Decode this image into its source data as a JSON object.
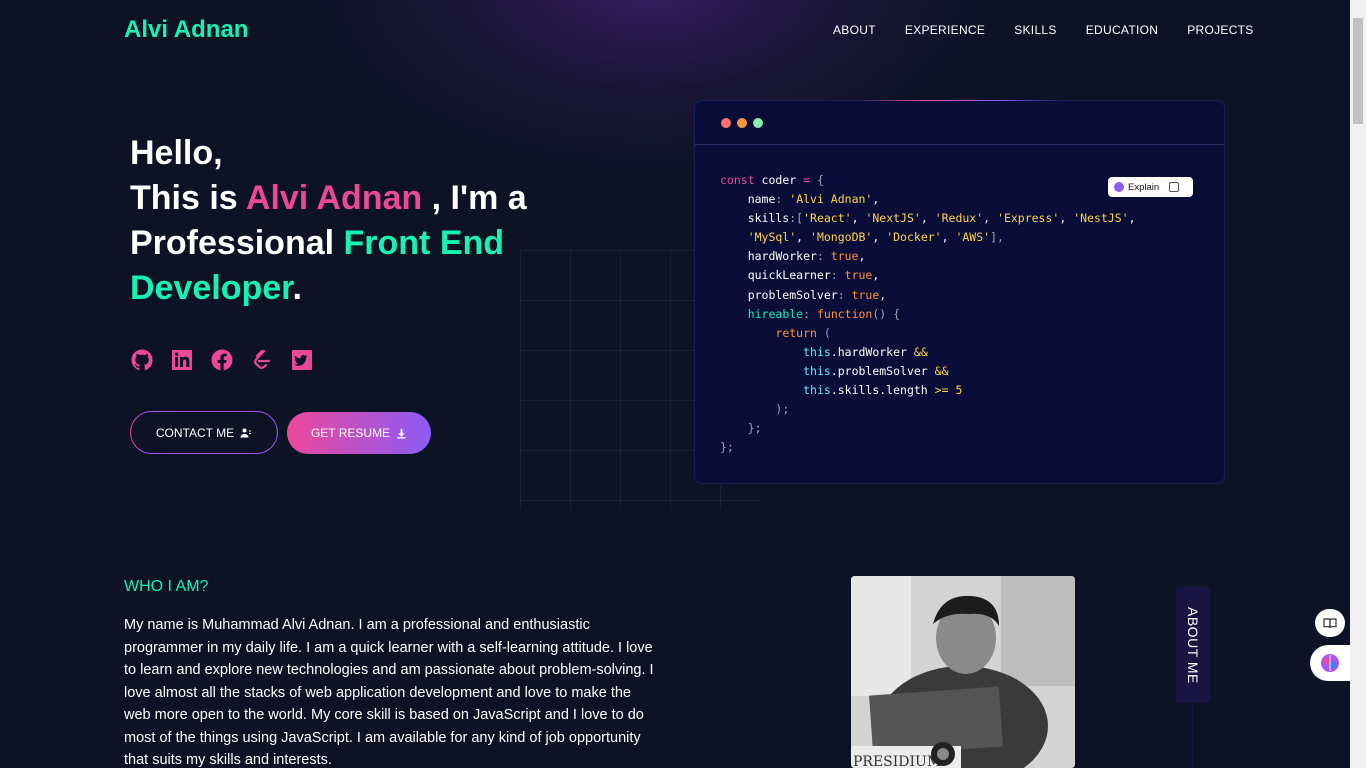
{
  "header": {
    "logo": "Alvi Adnan",
    "nav": [
      "ABOUT",
      "EXPERIENCE",
      "SKILLS",
      "EDUCATION",
      "PROJECTS"
    ]
  },
  "hero": {
    "line1": "Hello,",
    "this_is": "This is ",
    "name": "Alvi Adnan",
    "im_a": " , I'm a",
    "professional": "Professional ",
    "role": "Front End Developer",
    "period": ".",
    "socials": [
      "github-icon",
      "linkedin-icon",
      "facebook-icon",
      "leetcode-icon",
      "twitter-icon"
    ],
    "contact_label": "CONTACT ME",
    "resume_label": "GET RESUME"
  },
  "code": {
    "explain_label": "Explain",
    "name": "'Alvi Adnan'",
    "skills": [
      "'React'",
      "'NextJS'",
      "'Redux'",
      "'Express'",
      "'NestJS'",
      "'MySql'",
      "'MongoDB'",
      "'Docker'",
      "'AWS'"
    ],
    "length_min": "5"
  },
  "about": {
    "heading": "WHO I AM?",
    "text": "My name is Muhammad Alvi Adnan. I am a professional and enthusiastic programmer in my daily life. I am a quick learner with a self-learning attitude. I love to learn and explore new technologies and am passionate about problem-solving. I love almost all the stacks of web application development and love to make the web more open to the world. My core skill is based on JavaScript and I love to do most of the things using JavaScript. I am available for any kind of job opportunity that suits my skills and interests.",
    "tab_label": "ABOUT ME",
    "photo_caption": "PRESIDIUM"
  },
  "colors": {
    "background": "#0d1224",
    "accent_green": "#16f2b3",
    "accent_pink": "#ec4899",
    "accent_purple": "#8b5cf6"
  }
}
